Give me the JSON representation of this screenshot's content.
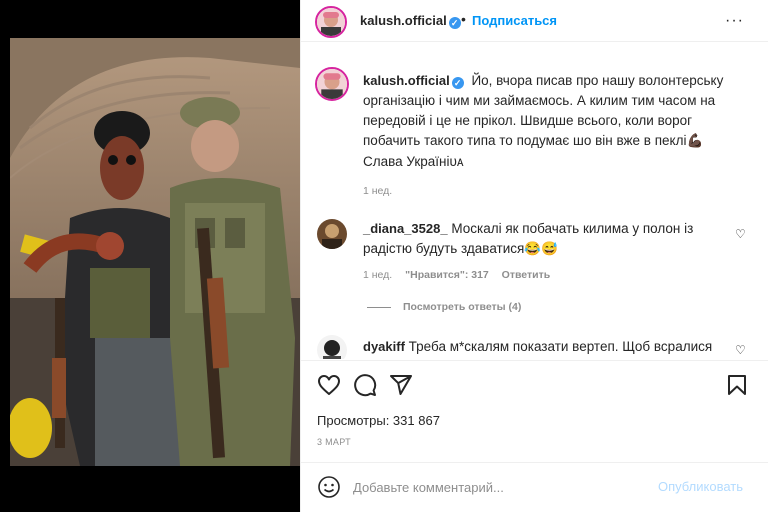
{
  "post": {
    "author": "kalush.official",
    "follow_label": "Подписаться",
    "dot": "•",
    "more": "···"
  },
  "caption": {
    "username": "kalush.official",
    "text": "Йо, вчора писав про нашу волонтерську організацію і чим ми займаємось. А килим тим часом на передовій і це не прікол. Швидше всього, коли ворог побачить такого типа то подумає шо він вже в пеклі💪🏿",
    "slava": "Слава Україніᴜᴀ",
    "time": "1 нед."
  },
  "comments": [
    {
      "username": "_diana_3528_",
      "text": "Москалі як побачать килима у полон із радістю будуть здаватися😂😅",
      "time": "1 нед.",
      "likes": "\"Нравится\": 317",
      "reply_label": "Ответить",
      "view_replies": "Посмотреть ответы (4)"
    },
    {
      "username": "dyakiff",
      "text": "Треба м*скалям показати вертеп. Щоб всралися сі."
    }
  ],
  "stats": {
    "views": "Просмотры: 331 867",
    "date": "3 МАРТ"
  },
  "composer": {
    "placeholder": "Добавьте комментарий...",
    "publish_label": "Опубликовать"
  },
  "icons": {
    "like": "heart-icon",
    "comment": "comment-icon",
    "share": "paper-plane-icon",
    "save": "bookmark-icon",
    "emoji": "smiley-icon"
  },
  "colors": {
    "link_blue": "#0095f6",
    "publish_disabled": "#b3dbff",
    "meta_gray": "#8e8e8e",
    "verified_blue": "#3897f0"
  }
}
